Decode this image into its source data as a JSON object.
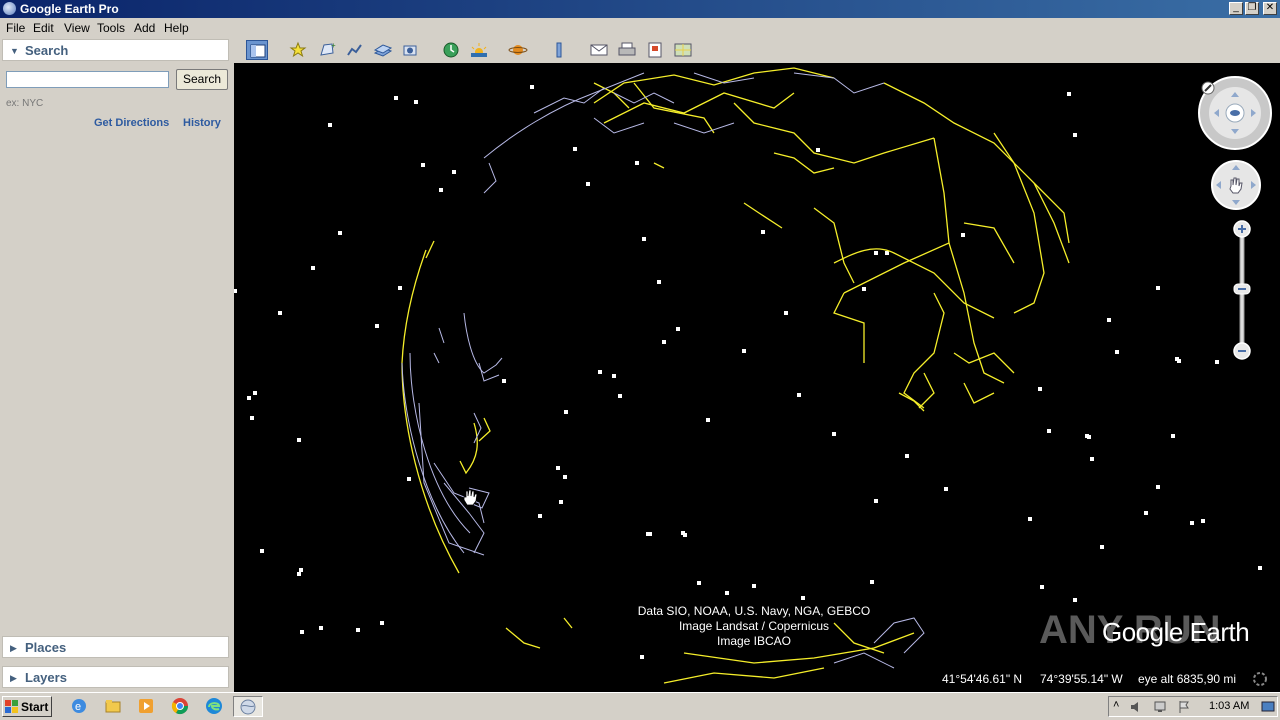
{
  "window": {
    "title": "Google Earth Pro"
  },
  "menu": [
    "File",
    "Edit",
    "View",
    "Tools",
    "Add",
    "Help"
  ],
  "search": {
    "header": "Search",
    "input_value": "",
    "button_label": "Search",
    "hint": "ex: NYC",
    "get_directions": "Get Directions",
    "history": "History"
  },
  "places": {
    "header": "Places"
  },
  "layers": {
    "header": "Layers"
  },
  "toolbar": {
    "icons": [
      "sidebar-icon",
      "placemark-icon",
      "polygon-icon",
      "path-icon",
      "image-overlay-icon",
      "record-tour-icon",
      "historical-imagery-icon",
      "sunlight-icon",
      "planets-icon",
      "ruler-icon",
      "email-icon",
      "print-icon",
      "save-image-icon",
      "view-in-maps-icon"
    ]
  },
  "map": {
    "attribution": [
      "Data SIO, NOAA, U.S. Navy, NGA, GEBCO",
      "Image Landsat / Copernicus",
      "Image IBCAO"
    ],
    "latitude": "41°54'46.61\" N",
    "longitude": "74°39'55.14\" W",
    "eye_alt": "eye alt 6835,90 mi",
    "logo": "Google Earth",
    "watermark": "ANY RUN"
  },
  "taskbar": {
    "start_label": "Start",
    "clock": "1:03 AM"
  },
  "colors": {
    "roads": "#f5ee2a",
    "borders": "#b7b9e6",
    "title_bar": "#0a246a",
    "link": "#2d5aa0"
  }
}
